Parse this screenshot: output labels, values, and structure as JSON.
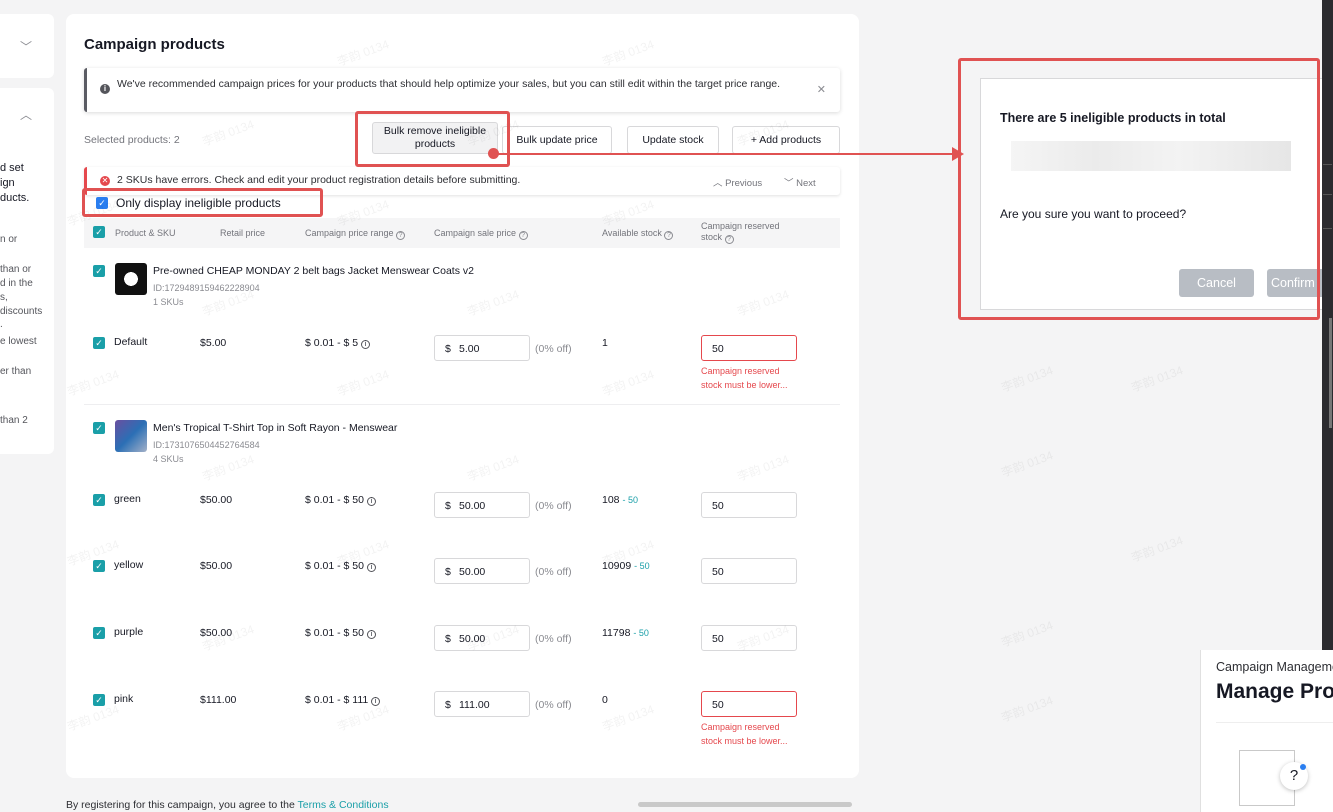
{
  "sidebar_fragments": [
    "d set",
    "ign",
    "ducts.",
    "n or",
    "than or",
    "d in the",
    "s,",
    "discounts",
    ".",
    "e lowest",
    "er than",
    "than 2"
  ],
  "card_title": "Campaign products",
  "info_banner": "We've recommended campaign prices for your products that should help optimize your sales, but you can still edit within the target price range.",
  "selected_label": "Selected products: 2",
  "toolbar": {
    "bulk_remove": "Bulk remove ineligible products",
    "bulk_update": "Bulk update price",
    "update_stock": "Update stock",
    "add_products": "+ Add products"
  },
  "error_banner": {
    "text": "2 SKUs have errors. Check and edit your product registration details before submitting.",
    "previous": "Previous",
    "next": "Next"
  },
  "only_ineligible_label": "Only display ineligible products",
  "columns": {
    "product_sku": "Product & SKU",
    "retail_price": "Retail price",
    "campaign_price_range": "Campaign price range",
    "campaign_sale_price": "Campaign sale price",
    "available_stock": "Available stock",
    "campaign_reserved_stock": "Campaign reserved stock"
  },
  "products": [
    {
      "name": "Pre-owned CHEAP MONDAY 2 belt bags Jacket Menswear Coats v2",
      "id": "ID:1729489159462228904",
      "skus_count": "1 SKUs",
      "skus": [
        {
          "name": "Default",
          "retail": "$5.00",
          "range": "$ 0.01 - $ 5",
          "currency": "$",
          "sale": "5.00",
          "off": "(0% off)",
          "stock": "1",
          "stock_add": "",
          "reserved": "50",
          "error": "Campaign reserved stock must be lower..."
        }
      ]
    },
    {
      "name": "Men's Tropical T-Shirt Top in Soft Rayon - Menswear",
      "id": "ID:1731076504452764584",
      "skus_count": "4 SKUs",
      "skus": [
        {
          "name": "green",
          "retail": "$50.00",
          "range": "$ 0.01 - $ 50",
          "currency": "$",
          "sale": "50.00",
          "off": "(0% off)",
          "stock": "108",
          "stock_add": "- 50",
          "reserved": "50",
          "error": ""
        },
        {
          "name": "yellow",
          "retail": "$50.00",
          "range": "$ 0.01 - $ 50",
          "currency": "$",
          "sale": "50.00",
          "off": "(0% off)",
          "stock": "10909",
          "stock_add": "- 50",
          "reserved": "50",
          "error": ""
        },
        {
          "name": "purple",
          "retail": "$50.00",
          "range": "$ 0.01 - $ 50",
          "currency": "$",
          "sale": "50.00",
          "off": "(0% off)",
          "stock": "11798",
          "stock_add": "- 50",
          "reserved": "50",
          "error": ""
        },
        {
          "name": "pink",
          "retail": "$111.00",
          "range": "$ 0.01 - $ 111",
          "currency": "$",
          "sale": "111.00",
          "off": "(0% off)",
          "stock": "0",
          "stock_add": "",
          "reserved": "50",
          "error": "Campaign reserved stock must be lower..."
        }
      ]
    }
  ],
  "footer": {
    "text": "By registering for this campaign, you agree to the ",
    "link": "Terms & Conditions"
  },
  "watermark": "李韵 0134",
  "dialog": {
    "heading": "There are 5 ineligible products in total",
    "question": "Are you sure you want to proceed?",
    "cancel": "Cancel",
    "confirm": "Confirm"
  },
  "bottom_card": {
    "breadcrumb": "Campaign Management",
    "title": "Manage Products"
  },
  "help_label": "?",
  "colors": {
    "accent": "#1a9fa8",
    "error": "#e5484d",
    "annotation": "#e05252",
    "checkbox_blue": "#2a7ef0"
  }
}
